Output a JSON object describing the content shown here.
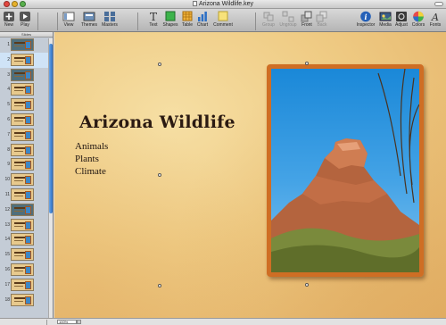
{
  "window": {
    "title": "Arizona Wildlife.key"
  },
  "toolbar": {
    "new": "New",
    "play": "Play",
    "view": "View",
    "themes": "Themes",
    "masters": "Masters",
    "text": "Text",
    "shapes": "Shapes",
    "table": "Table",
    "chart": "Chart",
    "comment": "Comment",
    "group": "Group",
    "ungroup": "Ungroup",
    "front": "Front",
    "back": "Back",
    "inspector": "Inspector",
    "media": "Media",
    "adjust": "Adjust",
    "colors": "Colors",
    "fonts": "Fonts"
  },
  "sidebar": {
    "header": "Slides",
    "slides": [
      {
        "num": "1",
        "style": "dark"
      },
      {
        "num": "2",
        "style": "light",
        "selected": true
      },
      {
        "num": "3",
        "style": "dark"
      },
      {
        "num": "4",
        "style": "light"
      },
      {
        "num": "5",
        "style": "light"
      },
      {
        "num": "6",
        "style": "light"
      },
      {
        "num": "7",
        "style": "light"
      },
      {
        "num": "8",
        "style": "light"
      },
      {
        "num": "9",
        "style": "light"
      },
      {
        "num": "10",
        "style": "light"
      },
      {
        "num": "11",
        "style": "light"
      },
      {
        "num": "12",
        "style": "dark"
      },
      {
        "num": "13",
        "style": "light"
      },
      {
        "num": "14",
        "style": "light"
      },
      {
        "num": "15",
        "style": "light"
      },
      {
        "num": "16",
        "style": "light"
      },
      {
        "num": "17",
        "style": "light"
      },
      {
        "num": "18",
        "style": "light"
      }
    ]
  },
  "slide": {
    "title": "Arizona Wildlife",
    "bullets": [
      "Animals",
      "Plants",
      "Climate"
    ]
  },
  "status": {
    "zoom": "100%"
  },
  "colors": {
    "frame": "#cf6e24",
    "canvas": "#efcb84",
    "accent": "#2b6fc6"
  }
}
